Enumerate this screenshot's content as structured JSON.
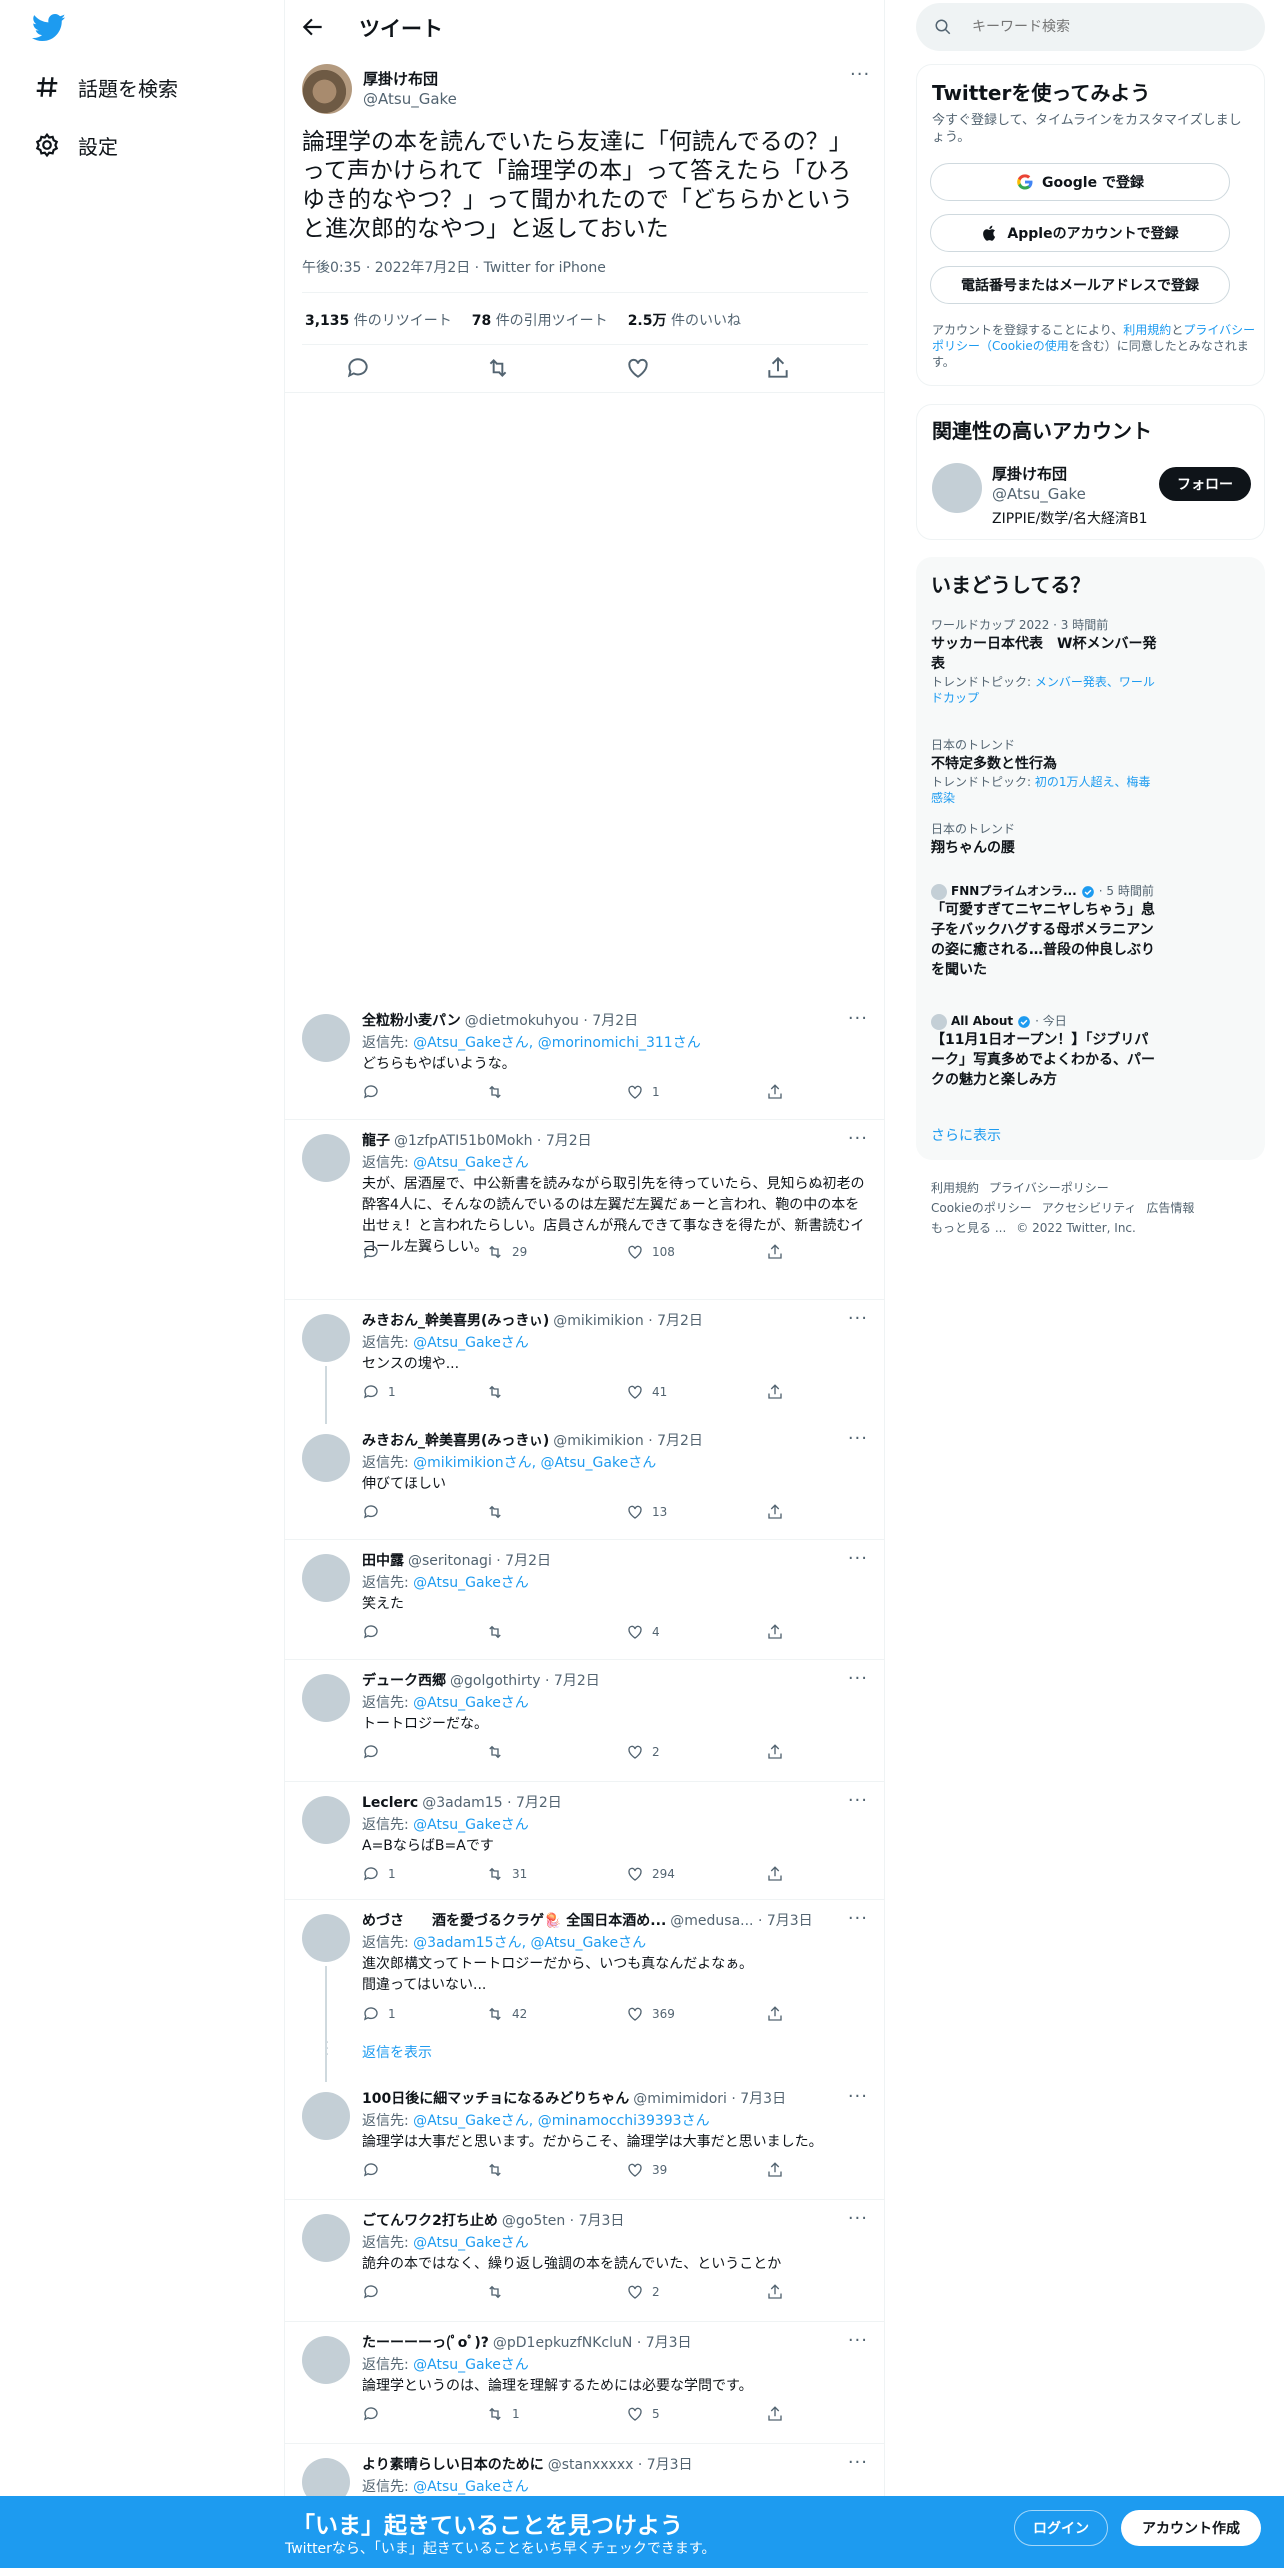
{
  "nav": {
    "explore_label": "話題を検索",
    "settings_label": "設定"
  },
  "header": {
    "title": "ツイート"
  },
  "tweet": {
    "name": "厚掛け布団",
    "handle": "@Atsu_Gake",
    "text": "論理学の本を読んでいたら友達に「何読んでるの？」って声かけられて「論理学の本」って答えたら「ひろゆき的なやつ？」って聞かれたので「どちらかというと進次郎的なやつ」と返しておいた",
    "meta": "午後0:35 · 2022年7月2日 · Twitter for iPhone",
    "retweets": "3,135",
    "retweets_label": "件のリツイート",
    "quotes": "78",
    "quotes_label": "件の引用ツイート",
    "likes": "2.5万",
    "likes_label": "件のいいね"
  },
  "replies": [
    {
      "name": "全粒粉小麦パン",
      "meta": "@dietmokuhyou · 7月2日",
      "replyto_prefix": "返信先: ",
      "replyto": "@Atsu_Gakeさん, @morinomichi_311さん",
      "text": "どちらもやばいような。",
      "replies": "",
      "retweets": "",
      "likes": "1"
    },
    {
      "name": "龍子",
      "meta": "@1zfpATI51b0Mokh · 7月2日",
      "replyto_prefix": "返信先: ",
      "replyto": "@Atsu_Gakeさん",
      "text": "夫が、居酒屋で、中公新書を読みながら取引先を待っていたら、見知らぬ初老の酔客4人に、そんなの読んでいるのは左翼だ左翼だぁーと言われ、鞄の中の本を出せぇ！と言われたらしい。店員さんが飛んできて事なきを得たが、新書読むイコール左翼らしい。",
      "replies": "",
      "retweets": "29",
      "likes": "108"
    },
    {
      "name": "みきおん_幹美喜男(みっきぃ)",
      "meta": "@mikimikion · 7月2日",
      "replyto_prefix": "返信先: ",
      "replyto": "@Atsu_Gakeさん",
      "text": "センスの塊や...",
      "replies": "1",
      "retweets": "",
      "likes": "41"
    },
    {
      "name": "みきおん_幹美喜男(みっきぃ)",
      "meta": "@mikimikion · 7月2日",
      "replyto_prefix": "返信先: ",
      "replyto": "@mikimikionさん, @Atsu_Gakeさん",
      "text": "伸びてほしい",
      "replies": "",
      "retweets": "",
      "likes": "13"
    },
    {
      "name": "田中露",
      "meta": "@seritonagi · 7月2日",
      "replyto_prefix": "返信先: ",
      "replyto": "@Atsu_Gakeさん",
      "text": "笑えた",
      "replies": "",
      "retweets": "",
      "likes": "4"
    },
    {
      "name": "デューク西郷",
      "meta": "@golgothirty · 7月2日",
      "replyto_prefix": "返信先: ",
      "replyto": "@Atsu_Gakeさん",
      "text": "トートロジーだな。",
      "replies": "",
      "retweets": "",
      "likes": "2"
    },
    {
      "name": "Leclerc",
      "meta": "@3adam15 · 7月2日",
      "replyto_prefix": "返信先: ",
      "replyto": "@Atsu_Gakeさん",
      "text": "A=BならばB=Aです",
      "replies": "1",
      "retweets": "31",
      "likes": "294"
    },
    {
      "name": "めづさ　　酒を愛づるクラゲ🪼 全国日本酒め...",
      "meta": "@medusa... · 7月3日",
      "replyto_prefix": "返信先: ",
      "replyto": "@3adam15さん, @Atsu_Gakeさん",
      "text": "進次郎構文ってトートロジーだから、いつも真なんだよなぁ。\n間違ってはいない...",
      "replies": "1",
      "retweets": "42",
      "likes": "369"
    },
    {
      "name": "100日後に細マッチョになるみどりちゃん",
      "meta": "@mimimidori · 7月3日",
      "replyto_prefix": "返信先: ",
      "replyto": "@Atsu_Gakeさん, @minamocchi39393さん",
      "text": "論理学は大事だと思います。だからこそ、論理学は大事だと思いました。",
      "replies": "",
      "retweets": "",
      "likes": "39"
    },
    {
      "name": "ごてんワク2打ち止め",
      "meta": "@go5ten · 7月3日",
      "replyto_prefix": "返信先: ",
      "replyto": "@Atsu_Gakeさん",
      "text": "詭弁の本ではなく、繰り返し強調の本を読んでいた、ということか",
      "replies": "",
      "retweets": "",
      "likes": "2"
    },
    {
      "name": "たーーーーっ(ﾟoﾟ)?",
      "meta": "@pD1epkuzfNKcluN · 7月3日",
      "replyto_prefix": "返信先: ",
      "replyto": "@Atsu_Gakeさん",
      "text": "論理学というのは、論理を理解するためには必要な学問です。",
      "replies": "",
      "retweets": "1",
      "likes": "5"
    },
    {
      "name": "より素晴らしい日本のために",
      "meta": "@stanxxxxx · 7月3日",
      "replyto_prefix": "返信先: ",
      "replyto": "@Atsu_Gakeさん",
      "text": "",
      "replies": "",
      "retweets": "",
      "likes": ""
    }
  ],
  "show_replies_label": "返信を表示",
  "sidebar": {
    "search_placeholder": "キーワード検索",
    "signup": {
      "title": "Twitterを使ってみよう",
      "subtitle": "今すぐ登録して、タイムラインをカスタマイズしましょう。",
      "google_label": "Google で登録",
      "apple_label": "Appleのアカウントで登録",
      "phone_label": "電話番号またはメールアドレスで登録",
      "legal_prefix": "アカウントを登録することにより、",
      "legal_link1": "利用規約",
      "legal_mid": "と",
      "legal_link2": "プライバシーポリシー（Cookieの使用",
      "legal_suffix": "を含む）に同意したとみなされます。"
    },
    "related": {
      "title": "関連性の高いアカウント",
      "name": "厚掛け布団",
      "handle": "@Atsu_Gake",
      "bio": "ZIPPIE/数学/名大経済B1",
      "follow_label": "フォロー"
    },
    "trends": {
      "title": "いまどうしてる？",
      "items": [
        {
          "context": "ワールドカップ 2022 · 3 時間前",
          "name": "サッカー日本代表　W杯メンバー発表",
          "topic_prefix": "トレンドトピック: ",
          "topic": "メンバー発表、ワールドカップ"
        },
        {
          "context": "日本のトレンド",
          "name": "不特定多数と性行為",
          "topic_prefix": "トレンドトピック: ",
          "topic": "初の1万人超え、梅毒感染"
        },
        {
          "context": "日本のトレンド",
          "name": "翔ちゃんの腰",
          "topic_prefix": "",
          "topic": ""
        },
        {
          "source": "FNNプライムオンラ...",
          "time": "· 5 時間前",
          "name": "「可愛すぎてニヤニヤしちゃう」息子をバックハグする母ポメラニアンの姿に癒される…普段の仲良しぶりを聞いた"
        },
        {
          "source": "All About",
          "time": "· 今日",
          "name": "【11月1日オープン！】「ジブリパーク」写真多めでよくわかる、パークの魅力と楽しみ方"
        }
      ],
      "show_more": "さらに表示"
    },
    "footer": [
      "利用規約",
      "プライバシーポリシー",
      "Cookieのポリシー",
      "アクセシビリティ",
      "広告情報",
      "もっと見る ...",
      "© 2022 Twitter, Inc."
    ]
  },
  "banner": {
    "title": "「いま」起きていることを見つけよう",
    "subtitle": "Twitterなら、「いま」起きていることをいち早くチェックできます。",
    "login_label": "ログイン",
    "signup_label": "アカウント作成"
  },
  "colors": {
    "accent": "#1d9bf0",
    "text": "#0f1419",
    "muted": "#536471"
  }
}
